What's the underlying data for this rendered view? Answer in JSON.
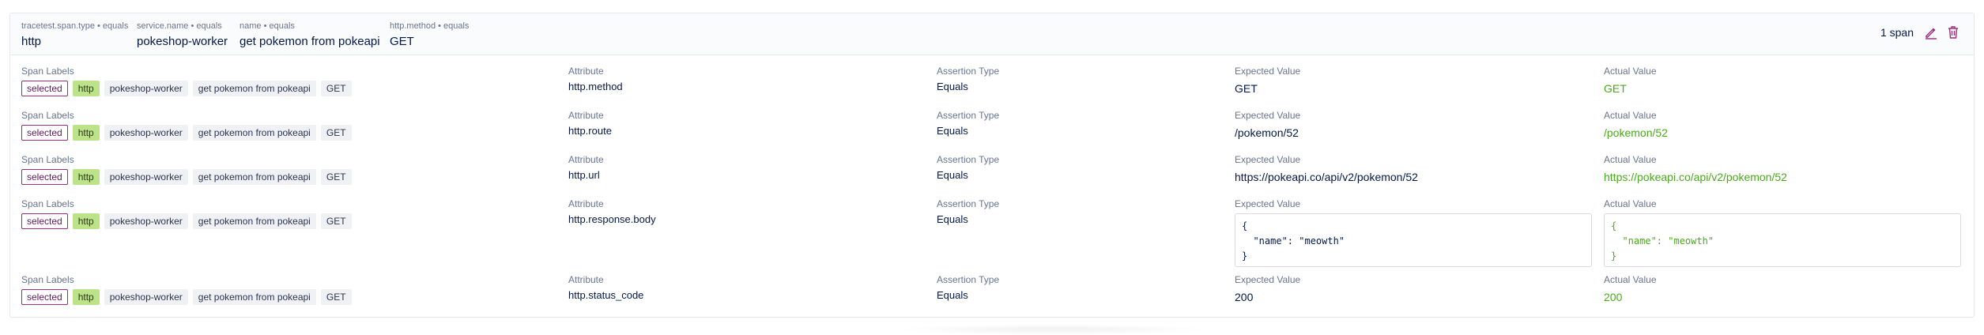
{
  "selectors": [
    {
      "key": "tracetest.span.type • equals",
      "value": "http"
    },
    {
      "key": "service.name • equals",
      "value": "pokeshop-worker"
    },
    {
      "key": "name • equals",
      "value": "get pokemon from pokeapi"
    },
    {
      "key": "http.method • equals",
      "value": "GET"
    }
  ],
  "span_count": "1 span",
  "icons": {
    "edit": "edit-icon",
    "delete": "trash-icon"
  },
  "labels": {
    "span_labels": "Span Labels",
    "attribute": "Attribute",
    "assertion_type": "Assertion Type",
    "expected_value": "Expected Value",
    "actual_value": "Actual Value"
  },
  "span_tags": {
    "selected": "selected",
    "type": "http",
    "service": "pokeshop-worker",
    "name": "get pokemon from pokeapi",
    "method": "GET"
  },
  "assertions": [
    {
      "attribute": "http.method",
      "type": "Equals",
      "expected": "GET",
      "actual": "GET"
    },
    {
      "attribute": "http.route",
      "type": "Equals",
      "expected": "/pokemon/52",
      "actual": "/pokemon/52"
    },
    {
      "attribute": "http.url",
      "type": "Equals",
      "expected": "https://pokeapi.co/api/v2/pokemon/52",
      "actual": "https://pokeapi.co/api/v2/pokemon/52"
    },
    {
      "attribute": "http.response.body",
      "type": "Equals",
      "expected": "{\n  \"name\": \"meowth\"\n}",
      "actual": "{\n  \"name\": \"meowth\"\n}"
    },
    {
      "attribute": "http.status_code",
      "type": "Equals",
      "expected": "200",
      "actual": "200"
    }
  ],
  "colors": {
    "actual_pass": "#49aa19",
    "selected_tag_border": "#9a2a7c",
    "type_tag_bg": "#bde38a",
    "text_primary": "#031849"
  }
}
